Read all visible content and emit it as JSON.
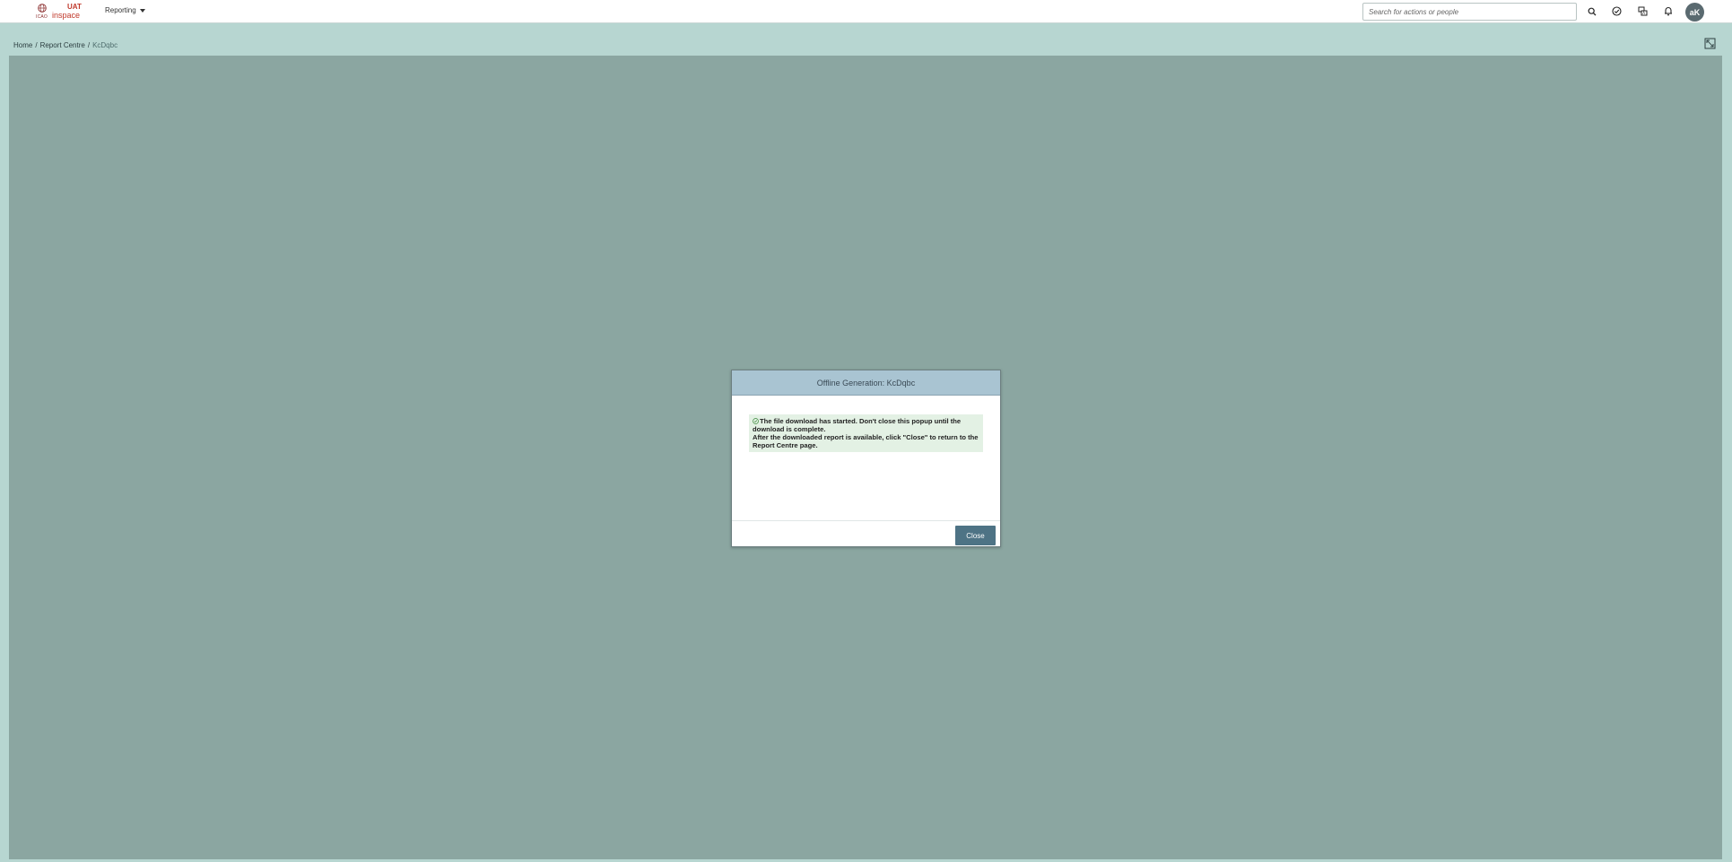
{
  "header": {
    "logo_small_text": "ICAO",
    "logo_env": "UAT",
    "logo_brand": "inspace",
    "menu_reporting": "Reporting",
    "search_placeholder": "Search for actions or people",
    "avatar_initials": "aK",
    "icons": [
      "search-icon",
      "check-circle-icon",
      "translate-icon",
      "bell-icon"
    ]
  },
  "breadcrumb": {
    "home": "Home",
    "separator": "/",
    "report_centre": "Report Centre",
    "current": "KcDqbc"
  },
  "modal": {
    "title": "Offline Generation: KcDqbc",
    "message_line1": "The file download has started. Don't close this popup until the download is complete.",
    "message_line2": "After the downloaded report is available, click \"Close\" to return to the Report Centre page.",
    "close_label": "Close"
  },
  "colors": {
    "accent_button": "#4e7385",
    "modal_header": "#a9c4d2",
    "page_band": "#b7d6d1",
    "overlay": "#8ba6a1",
    "message_bg": "#e3f1e4",
    "brand_red": "#c0392b"
  }
}
